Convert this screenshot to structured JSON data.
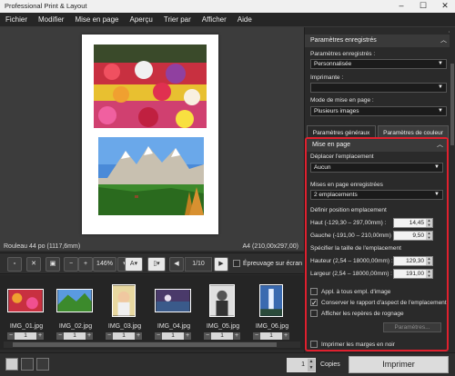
{
  "window": {
    "title": "Professional Print & Layout",
    "minimize_icon": "minimize-icon",
    "maximize_icon": "maximize-icon",
    "close_icon": "close-icon"
  },
  "menu": {
    "items": [
      "Fichier",
      "Modifier",
      "Mise en page",
      "Aperçu",
      "Trier par",
      "Afficher",
      "Aide"
    ]
  },
  "preview": {
    "paper_name": "Rouleau 44 po (1117,6mm)",
    "paper_size": "A4 (210,00x297,00)"
  },
  "toolbar": {
    "zoom": "146%",
    "page_indicator": "1/10",
    "softproof_label": "Épreuvage sur écran",
    "softproof_checked": false
  },
  "thumbnails": [
    {
      "name": "IMG_01.jpg",
      "count": "1"
    },
    {
      "name": "IMG_02.jpg",
      "count": "1"
    },
    {
      "name": "IMG_03.jpg",
      "count": "1"
    },
    {
      "name": "IMG_04.jpg",
      "count": "1"
    },
    {
      "name": "IMG_05.jpg",
      "count": "1"
    },
    {
      "name": "IMG_06.jpg",
      "count": "1"
    }
  ],
  "bottom": {
    "copies_value": "1",
    "copies_label": "Copies",
    "print_label": "Imprimer"
  },
  "panel": {
    "saved_header": "Paramètres enregistrés",
    "saved_label": "Paramètres enregistrés :",
    "saved_value": "Personnalisée",
    "printer_label": "Imprimante :",
    "printer_value": "",
    "layout_mode_label": "Mode de mise en page :",
    "layout_mode_value": "Plusieurs images",
    "tab_general": "Paramètres généraux",
    "tab_color": "Paramètres de couleur",
    "layout_header": "Mise en page",
    "move_label": "Déplacer l'emplacement",
    "move_value": "Aucun",
    "saved_layouts_label": "Mises en page enregistrées",
    "saved_layouts_value": "2 emplacements",
    "position_label": "Définir position emplacement",
    "top_label": "Haut (-129,30 – 297,00mm) :",
    "top_value": "14,45",
    "left_label": "Gauche (-191,00 – 210,00mm) :",
    "left_value": "9,50",
    "size_label": "Spécifier la taille de l'emplacement",
    "height_label": "Hauteur (2,54 – 18000,00mm) :",
    "height_value": "129,30",
    "width_label": "Largeur (2,54 – 18000,00mm) :",
    "width_value": "191,00",
    "apply_all_label": "Appl. à tous empl. d'image",
    "apply_all_checked": false,
    "keep_ratio_label": "Conserver le rapport d'aspect de l'emplacement",
    "keep_ratio_checked": true,
    "crop_marks_label": "Afficher les repères de rognage",
    "crop_marks_checked": false,
    "params_button": "Paramètres...",
    "print_margins_label": "Imprimer les marges en noir",
    "print_margins_checked": false
  },
  "colors": {
    "highlight_frame": "#e0202e",
    "panel_bg": "#2a2a2a",
    "preview_bg": "#3c3c3c"
  }
}
